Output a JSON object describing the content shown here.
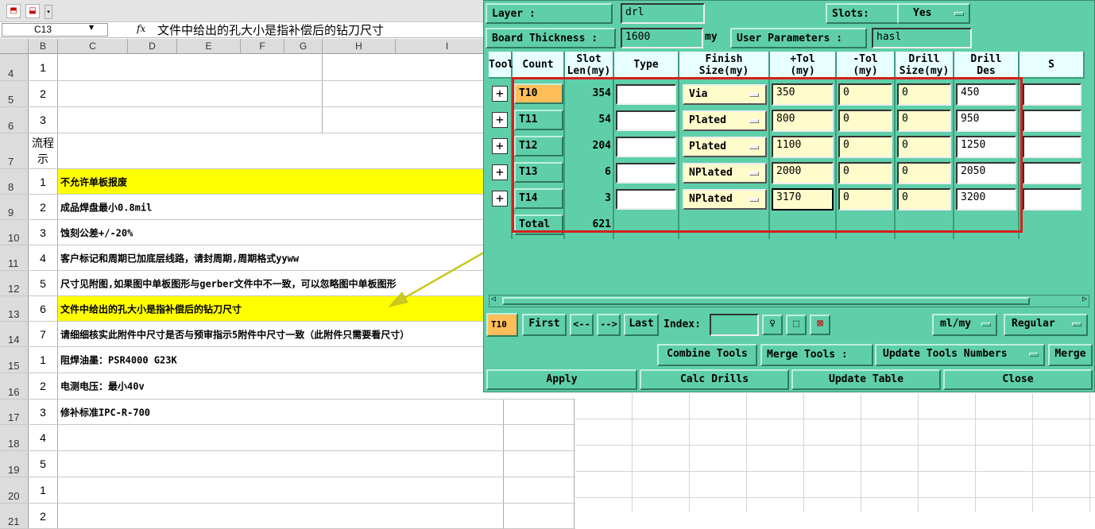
{
  "excel": {
    "toolbar_icons": [
      "pdf-icon",
      "pdf-comment-icon"
    ],
    "name_box": "C13",
    "fx_label": "fx",
    "formula": "文件中给出的孔大小是指补偿后的钻刀尺寸",
    "columns": [
      "B",
      "C",
      "D",
      "E",
      "F",
      "G",
      "H",
      "I"
    ],
    "rows": [
      {
        "num": "4",
        "b": "1",
        "c": ""
      },
      {
        "num": "5",
        "b": "2",
        "c": ""
      },
      {
        "num": "6",
        "b": "3",
        "c": ""
      },
      {
        "num": "7",
        "b": "流程\n示",
        "c": ""
      },
      {
        "num": "8",
        "b": "1",
        "c": "不允许单板报废",
        "highlight": true
      },
      {
        "num": "9",
        "b": "2",
        "c": "成品焊盘最小0.8mil"
      },
      {
        "num": "10",
        "b": "3",
        "c": "蚀刻公差+/-20%"
      },
      {
        "num": "11",
        "b": "4",
        "c": "客户标记和周期已加底层线路，请封周期,周期格式yyww"
      },
      {
        "num": "12",
        "b": "5",
        "c": "尺寸见附图,如果图中单板图形与gerber文件中不一致，可以忽略图中单板图形"
      },
      {
        "num": "13",
        "b": "6",
        "c": "文件中给出的孔大小是指补偿后的钻刀尺寸",
        "highlight": true
      },
      {
        "num": "14",
        "b": "7",
        "c": "请细细核实此附件中尺寸是否与预审指示5附件中尺寸一致（此附件只需要看尺寸）"
      },
      {
        "num": "15",
        "b": "1",
        "c": "阻焊油墨：PSR4000 G23K"
      },
      {
        "num": "16",
        "b": "2",
        "c": "电测电压：最小40v"
      },
      {
        "num": "17",
        "b": "3",
        "c": "修补标准IPC-R-700"
      },
      {
        "num": "18",
        "b": "4",
        "c": ""
      },
      {
        "num": "19",
        "b": "5",
        "c": ""
      },
      {
        "num": "20",
        "b": "1",
        "c": ""
      },
      {
        "num": "21",
        "b": "2",
        "c": ""
      }
    ],
    "colors": {
      "highlight": "#ffff00",
      "arrow": "#c8c820"
    }
  },
  "dialog": {
    "layer_label": "Layer            :",
    "layer_value": "drl",
    "slots_label": "Slots:",
    "slots_value": "Yes",
    "board_thickness_label": "Board Thickness :",
    "board_thickness_value": "1600",
    "board_thickness_unit": "my",
    "user_params_label": "User Parameters :",
    "user_params_value": "hasl",
    "headers": [
      "Tool",
      "Count",
      "Slot\nLen(my)",
      "Type",
      "Finish\nSize(my)",
      "+Tol\n(my)",
      "-Tol\n(my)",
      "Drill\nSize(my)",
      "Drill\nDes",
      "S"
    ],
    "tools": [
      {
        "tool": "T10",
        "count": "354",
        "slot_len": "",
        "type": "Via",
        "finish": "350",
        "ptol": "0",
        "ntol": "0",
        "drill": "450",
        "des": "",
        "selected": true
      },
      {
        "tool": "T11",
        "count": "54",
        "slot_len": "",
        "type": "Plated",
        "finish": "800",
        "ptol": "0",
        "ntol": "0",
        "drill": "950",
        "des": ""
      },
      {
        "tool": "T12",
        "count": "204",
        "slot_len": "",
        "type": "Plated",
        "finish": "1100",
        "ptol": "0",
        "ntol": "0",
        "drill": "1250",
        "des": ""
      },
      {
        "tool": "T13",
        "count": "6",
        "slot_len": "",
        "type": "NPlated",
        "finish": "2000",
        "ptol": "0",
        "ntol": "0",
        "drill": "2050",
        "des": ""
      },
      {
        "tool": "T14",
        "count": "3",
        "slot_len": "",
        "type": "NPlated",
        "finish": "3170",
        "ptol": "0",
        "ntol": "0",
        "drill": "3200",
        "des": ""
      }
    ],
    "total_label": "Total",
    "total_count": "621",
    "nav": {
      "current": "T10",
      "first": "First",
      "prev": "<--",
      "next": "-->",
      "last": "Last",
      "index_label": "Index:",
      "index_value": "",
      "units": "ml/my",
      "mode": "Regular"
    },
    "combine_tools": "Combine Tools",
    "merge_tools_label": "Merge Tools :",
    "update_numbers": "Update Tools Numbers",
    "merge": "Merge",
    "apply": "Apply",
    "calc_drills": "Calc Drills",
    "update_table": "Update Table",
    "close": "Close",
    "colors": {
      "bg": "#5fcfa9",
      "header": "#e8ffff",
      "input": "#fffccc",
      "selected_tool": "#ffbe5a",
      "highlight_box": "#d42020"
    }
  }
}
